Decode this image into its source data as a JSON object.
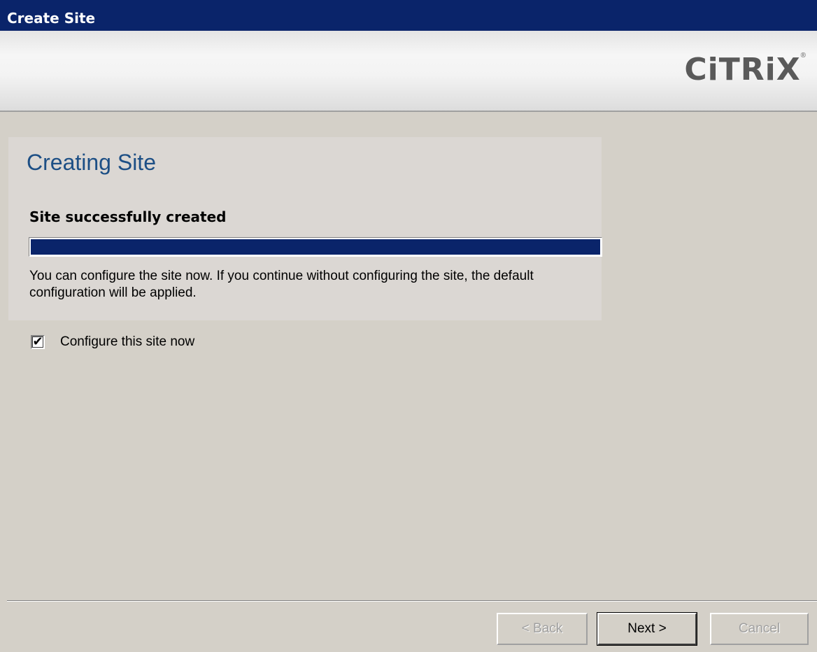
{
  "window": {
    "title": "Create Site"
  },
  "banner": {
    "logo_text": "CiTRiX",
    "logo_registered": "®"
  },
  "main": {
    "heading": "Creating Site",
    "status_label": "Site successfully created",
    "progress_percent": 100,
    "description": "You can configure the site now. If you continue without configuring the site, the default configuration will be applied.",
    "configure_checkbox": {
      "label": "Configure this site now",
      "checked": true,
      "mark": "✔"
    }
  },
  "footer": {
    "back_label": "< Back",
    "next_label": "Next >",
    "cancel_label": "Cancel"
  },
  "colors": {
    "title_bar": "#0a246a",
    "heading": "#1d4f85",
    "progress": "#0a246a"
  }
}
